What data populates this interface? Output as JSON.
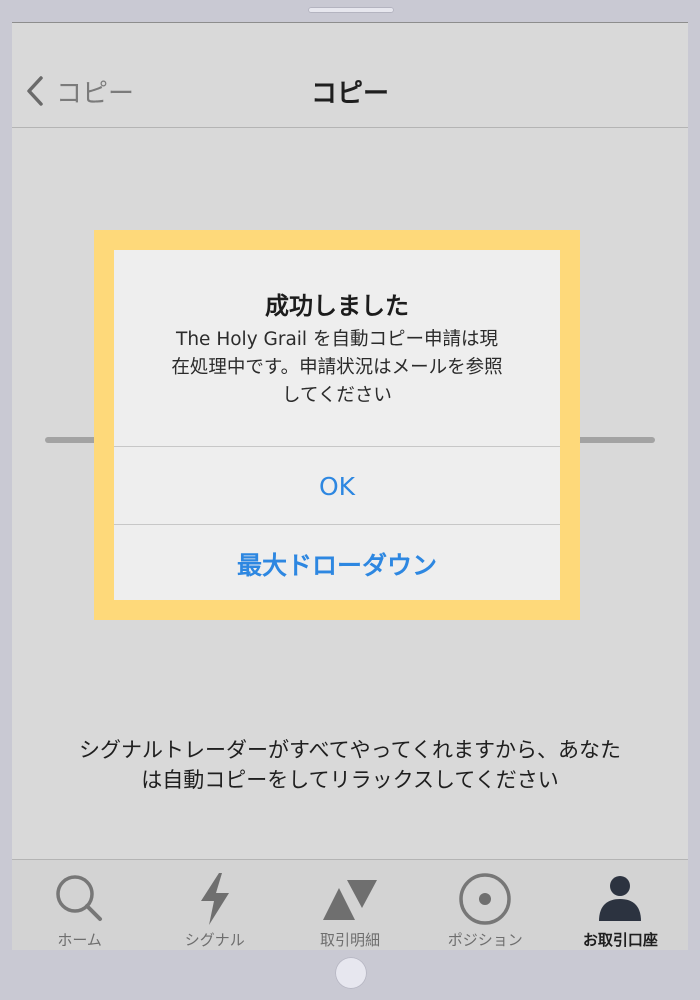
{
  "nav": {
    "back_label": "コピー",
    "title": "コピー"
  },
  "description": {
    "line1": "シグナルトレーダーがすべてやってくれますから、あなた",
    "line2": "は自動コピーをしてリラックスしてください"
  },
  "dialog": {
    "title": "成功しました",
    "message_line1": "The Holy Grail を自動コピー申請は現",
    "message_line2": "在処理中です。申請状況はメールを参照",
    "message_line3": "してください",
    "ok_label": "OK",
    "secondary_label": "最大ドローダウン"
  },
  "tabs": [
    {
      "label": "ホーム",
      "icon": "search-icon"
    },
    {
      "label": "シグナル",
      "icon": "lightning-icon"
    },
    {
      "label": "取引明細",
      "icon": "triangles-icon"
    },
    {
      "label": "ポジション",
      "icon": "target-icon"
    },
    {
      "label": "お取引口座",
      "icon": "person-icon"
    }
  ],
  "colors": {
    "accent": "#2d87e1",
    "highlight": "#fed97a"
  }
}
